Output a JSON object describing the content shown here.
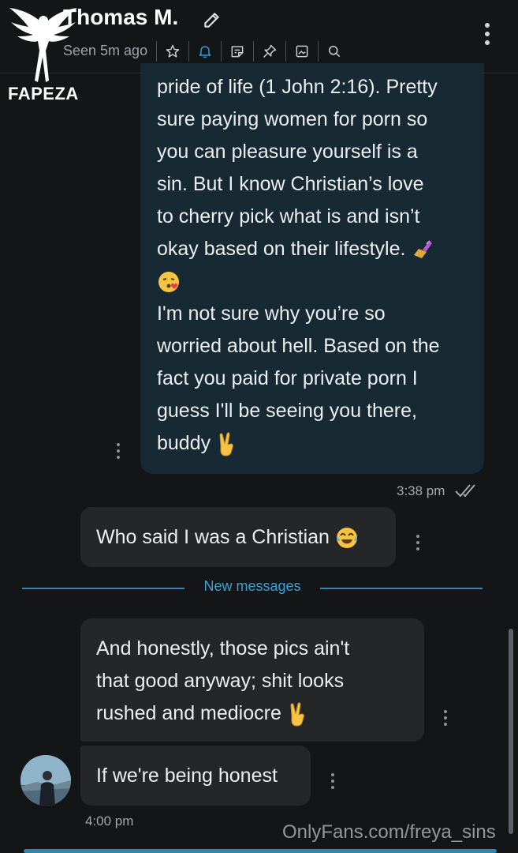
{
  "header": {
    "contact_name": "Thomas M.",
    "last_seen": "Seen 5m ago",
    "toolbar": [
      {
        "icon": "star-icon",
        "label": "Favorite"
      },
      {
        "icon": "bell-icon",
        "label": "Notifications"
      },
      {
        "icon": "note-icon",
        "label": "Notes"
      },
      {
        "icon": "pin-icon",
        "label": "Pin"
      },
      {
        "icon": "media-icon",
        "label": "Media"
      },
      {
        "icon": "search-icon",
        "label": "Search"
      }
    ]
  },
  "watermark_logo": {
    "text": "FAPEZA"
  },
  "messages": [
    {
      "direction": "sent",
      "lines": [
        "pride of life (1 John 2:16). Pretty",
        "sure paying women for porn so",
        "you can pleasure yourself is a",
        "sin. But I know Christian’s love",
        "to cherry pick what is and isn’t",
        "okay based on their lifestyle."
      ],
      "line6_emoji": "nail-polish-emoji",
      "line7_emoji": "kiss-emoji",
      "lines_2": [
        "I'm not sure why you’re so",
        "worried about hell. Based on the",
        "fact you paid for private porn I",
        "guess I'll be seeing you there,",
        "buddy"
      ],
      "end_emoji": "victory-hand-emoji",
      "time": "3:38 pm",
      "status": "read"
    },
    {
      "direction": "received",
      "text": "Who said I was a Christian",
      "emoji": "tears-of-joy-emoji"
    },
    {
      "direction": "received",
      "lines": [
        "And honestly, those pics ain't",
        "that good anyway; shit looks",
        "rushed and mediocre"
      ],
      "emoji": "victory-hand-emoji"
    },
    {
      "direction": "received",
      "text": "If we're being honest",
      "time": "4:00 pm"
    }
  ],
  "divider": {
    "label": "New messages"
  },
  "watermark": {
    "text": "OnlyFans.com/freya_sins"
  },
  "colors": {
    "background": "#141517",
    "sent_bubble": "#172a33",
    "received_bubble": "#252628",
    "accent": "#2f86b3"
  }
}
